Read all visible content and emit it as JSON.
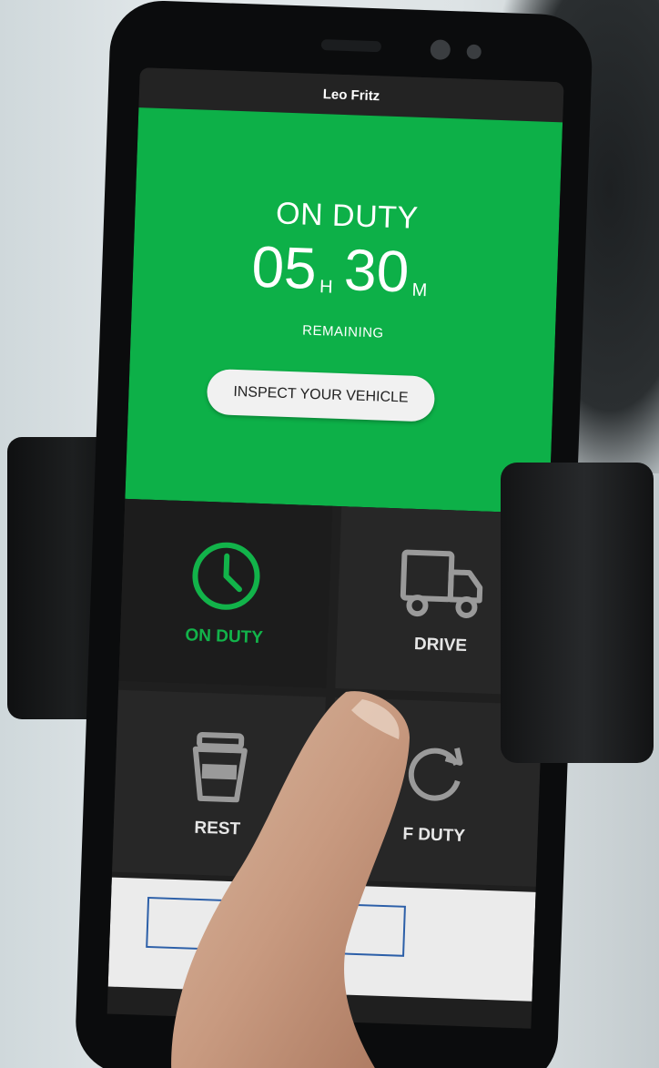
{
  "header": {
    "user_name": "Leo Fritz"
  },
  "status": {
    "title": "ON DUTY",
    "hours": "05",
    "hours_unit": "H",
    "minutes": "30",
    "minutes_unit": "M",
    "remaining_label": "REMAINING",
    "inspect_button": "INSPECT YOUR VEHICLE"
  },
  "tiles": [
    {
      "label": "ON DUTY",
      "icon": "clock-icon",
      "active": true
    },
    {
      "label": "DRIVE",
      "icon": "truck-icon",
      "active": false
    },
    {
      "label": "REST",
      "icon": "coffee-cup-icon",
      "active": false
    },
    {
      "label": "F DUTY",
      "icon": "refresh-icon",
      "active": false
    }
  ],
  "colors": {
    "accent_green": "#0db048",
    "tile_bg": "#272727",
    "button_border": "#2c5fa8"
  }
}
